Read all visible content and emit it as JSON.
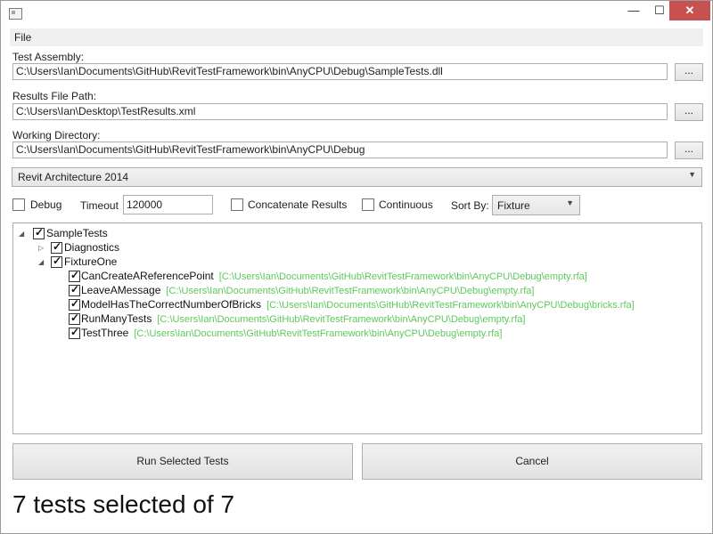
{
  "window": {
    "title_controls": {
      "minimize": "—",
      "maximize": "☐",
      "close": "✕"
    }
  },
  "menu": {
    "file": "File"
  },
  "form": {
    "test_assembly_label": "Test Assembly:",
    "test_assembly_value": "C:\\Users\\Ian\\Documents\\GitHub\\RevitTestFramework\\bin\\AnyCPU\\Debug\\SampleTests.dll",
    "results_label": "Results File Path:",
    "results_value": "C:\\Users\\Ian\\Desktop\\TestResults.xml",
    "working_dir_label": "Working Directory:",
    "working_dir_value": "C:\\Users\\Ian\\Documents\\GitHub\\RevitTestFramework\\bin\\AnyCPU\\Debug",
    "browse_label": "...",
    "revit_version": "Revit Architecture 2014"
  },
  "options": {
    "debug_label": "Debug",
    "debug_checked": false,
    "timeout_label": "Timeout",
    "timeout_value": "120000",
    "concat_label": "Concatenate Results",
    "concat_checked": false,
    "continuous_label": "Continuous",
    "continuous_checked": false,
    "sort_label": "Sort By:",
    "sort_value": "Fixture"
  },
  "tree": {
    "root": "SampleTests",
    "diagnostics": "Diagnostics",
    "fixture": "FixtureOne",
    "tests": [
      {
        "name": "CanCreateAReferencePoint",
        "path": "[C:\\Users\\Ian\\Documents\\GitHub\\RevitTestFramework\\bin\\AnyCPU\\Debug\\empty.rfa]"
      },
      {
        "name": "LeaveAMessage",
        "path": "[C:\\Users\\Ian\\Documents\\GitHub\\RevitTestFramework\\bin\\AnyCPU\\Debug\\empty.rfa]"
      },
      {
        "name": "ModelHasTheCorrectNumberOfBricks",
        "path": "[C:\\Users\\Ian\\Documents\\GitHub\\RevitTestFramework\\bin\\AnyCPU\\Debug\\bricks.rfa]"
      },
      {
        "name": "RunManyTests",
        "path": "[C:\\Users\\Ian\\Documents\\GitHub\\RevitTestFramework\\bin\\AnyCPU\\Debug\\empty.rfa]"
      },
      {
        "name": "TestThree",
        "path": "[C:\\Users\\Ian\\Documents\\GitHub\\RevitTestFramework\\bin\\AnyCPU\\Debug\\empty.rfa]"
      }
    ]
  },
  "actions": {
    "run": "Run Selected Tests",
    "cancel": "Cancel"
  },
  "status": "7 tests selected of 7",
  "colors": {
    "close_button": "#c75050",
    "path_text": "#5ec85e"
  }
}
